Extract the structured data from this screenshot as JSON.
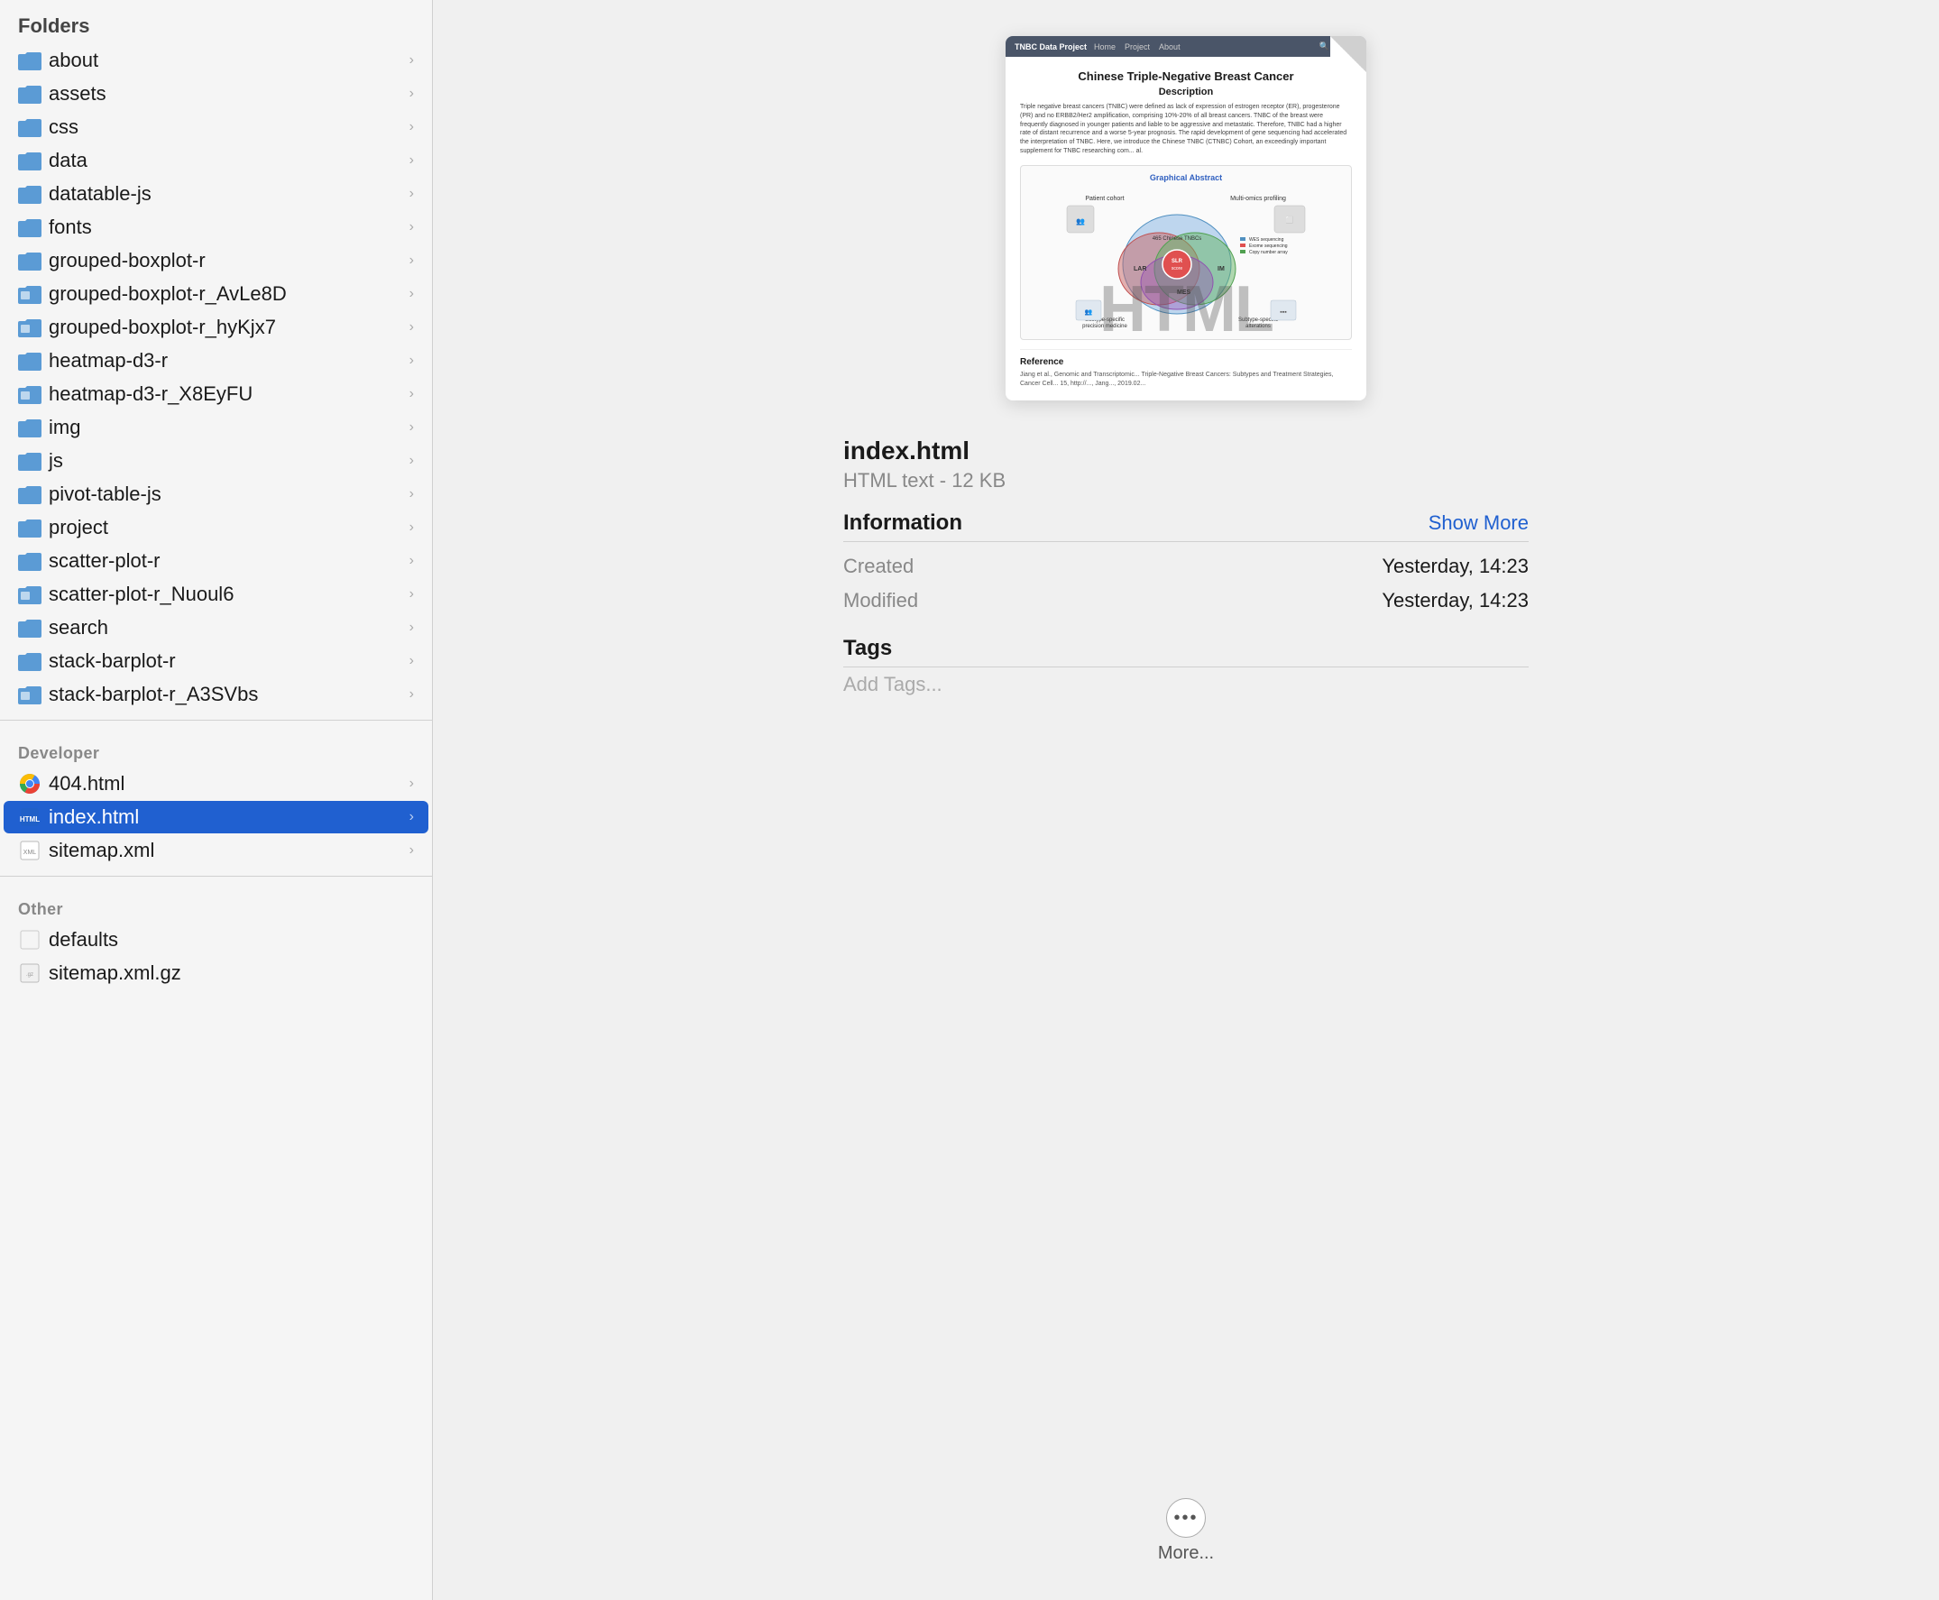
{
  "left_panel": {
    "folders_label": "Folders",
    "folders": [
      {
        "name": "about",
        "type": "folder",
        "has_badge": false
      },
      {
        "name": "assets",
        "type": "folder",
        "has_badge": false
      },
      {
        "name": "css",
        "type": "folder",
        "has_badge": false
      },
      {
        "name": "data",
        "type": "folder",
        "has_badge": false
      },
      {
        "name": "datatable-js",
        "type": "folder",
        "has_badge": false
      },
      {
        "name": "fonts",
        "type": "folder",
        "has_badge": false
      },
      {
        "name": "grouped-boxplot-r",
        "type": "folder",
        "has_badge": false
      },
      {
        "name": "grouped-boxplot-r_AvLe8D",
        "type": "folder-special",
        "has_badge": true
      },
      {
        "name": "grouped-boxplot-r_hyKjx7",
        "type": "folder-special",
        "has_badge": true
      },
      {
        "name": "heatmap-d3-r",
        "type": "folder",
        "has_badge": false
      },
      {
        "name": "heatmap-d3-r_X8EyFU",
        "type": "folder-special",
        "has_badge": true
      },
      {
        "name": "img",
        "type": "folder",
        "has_badge": false
      },
      {
        "name": "js",
        "type": "folder",
        "has_badge": false
      },
      {
        "name": "pivot-table-js",
        "type": "folder",
        "has_badge": false
      },
      {
        "name": "project",
        "type": "folder",
        "has_badge": false
      },
      {
        "name": "scatter-plot-r",
        "type": "folder",
        "has_badge": false
      },
      {
        "name": "scatter-plot-r_Nuoul6",
        "type": "folder-special",
        "has_badge": true
      },
      {
        "name": "search",
        "type": "folder",
        "has_badge": false
      },
      {
        "name": "stack-barplot-r",
        "type": "folder",
        "has_badge": false
      },
      {
        "name": "stack-barplot-r_A3SVbs",
        "type": "folder-special",
        "has_badge": true
      }
    ],
    "developer_label": "Developer",
    "developer_files": [
      {
        "name": "404.html",
        "type": "html-chrome"
      },
      {
        "name": "index.html",
        "type": "html-selected",
        "selected": true
      },
      {
        "name": "sitemap.xml",
        "type": "xml"
      }
    ],
    "other_label": "Other",
    "other_files": [
      {
        "name": "defaults",
        "type": "defaults"
      },
      {
        "name": "sitemap.xml.gz",
        "type": "gz"
      }
    ]
  },
  "preview": {
    "navbar_brand": "TNBC Data Project",
    "nav_links": [
      "Home",
      "Project",
      "About"
    ],
    "nav_search": "Search",
    "title": "Chinese Triple-Negative Breast Cancer",
    "subtitle": "Description",
    "body_text": "Triple negative breast cancers (TNBC) were defined as lack of expression of estrogen receptor (ER), progesterone (PR) and no ERBB2/Her2 amplification, comprising 10%-20% of all breast cancers. TNBC of the breast were frequently diagnosed in younger patients and liable to be aggressive and metastatic. Therefore, TNBC had a higher rate of distant recurrence and a worse 5-year prognosis. The rapid development of gene sequencing had accelerated the interpretation of TNBC. Here, we introduce the Chinese TNBC (CTNBC) Cohort, an exceedingly important supplement for TNBC researching com... al.",
    "graphical_abstract_title": "Graphical Abstract",
    "reference_title": "Reference",
    "reference_text": "Jiang et al., Genomic and Transcriptomic... Triple-Negative Breast Cancers: Subtypes and Treatment Strategies, Cancer Cell... 15, http://..., Jang..., 2019.02...",
    "html_watermark": "HTML"
  },
  "file_info": {
    "name": "index.html",
    "type_label": "HTML text - 12 KB",
    "information_title": "Information",
    "show_more_label": "Show More",
    "created_label": "Created",
    "created_value": "Yesterday, 14:23",
    "modified_label": "Modified",
    "modified_value": "Yesterday, 14:23",
    "tags_title": "Tags",
    "add_tags_placeholder": "Add Tags..."
  },
  "bottom": {
    "more_label": "More..."
  }
}
